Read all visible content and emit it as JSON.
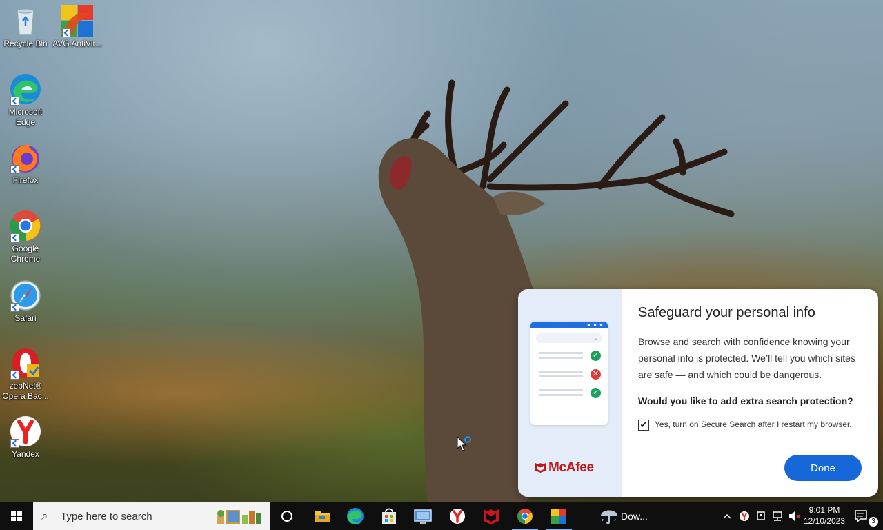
{
  "desktop_icons": [
    {
      "label": "Recycle Bin",
      "icon": "recycle-bin-icon"
    },
    {
      "label": "AVG AntiVir...",
      "icon": "avg-antivirus-icon"
    },
    {
      "label": "Microsoft Edge",
      "icon": "edge-icon"
    },
    {
      "label": "Firefox",
      "icon": "firefox-icon"
    },
    {
      "label": "Google Chrome",
      "icon": "chrome-icon"
    },
    {
      "label": "Safari",
      "icon": "safari-icon"
    },
    {
      "label": "zebNet® Opera Bac...",
      "icon": "opera-backup-icon"
    },
    {
      "label": "Yandex",
      "icon": "yandex-icon"
    }
  ],
  "dialog": {
    "title": "Safeguard your personal info",
    "body": "Browse and search with confidence knowing your personal info is protected. We’ll tell you which sites are safe — and which could be dangerous.",
    "question": "Would you like to add extra search protection?",
    "checkbox_label": "Yes, turn on Secure Search after I restart my browser.",
    "checkbox_checked": true,
    "done_label": "Done",
    "brand": "McAfee",
    "accent": "#1668d9",
    "brand_color": "#c01818"
  },
  "taskbar": {
    "search_placeholder": "Type here to search",
    "pinned": [
      "task-view-icon",
      "file-explorer-icon",
      "edge-icon",
      "microsoft-store-icon",
      "remote-desktop-icon",
      "yandex-icon",
      "mcafee-icon",
      "chrome-icon",
      "avg-icon"
    ],
    "weather_label": "Dow...",
    "time": "9:01 PM",
    "date": "12/10/2023",
    "notification_count": "3"
  }
}
